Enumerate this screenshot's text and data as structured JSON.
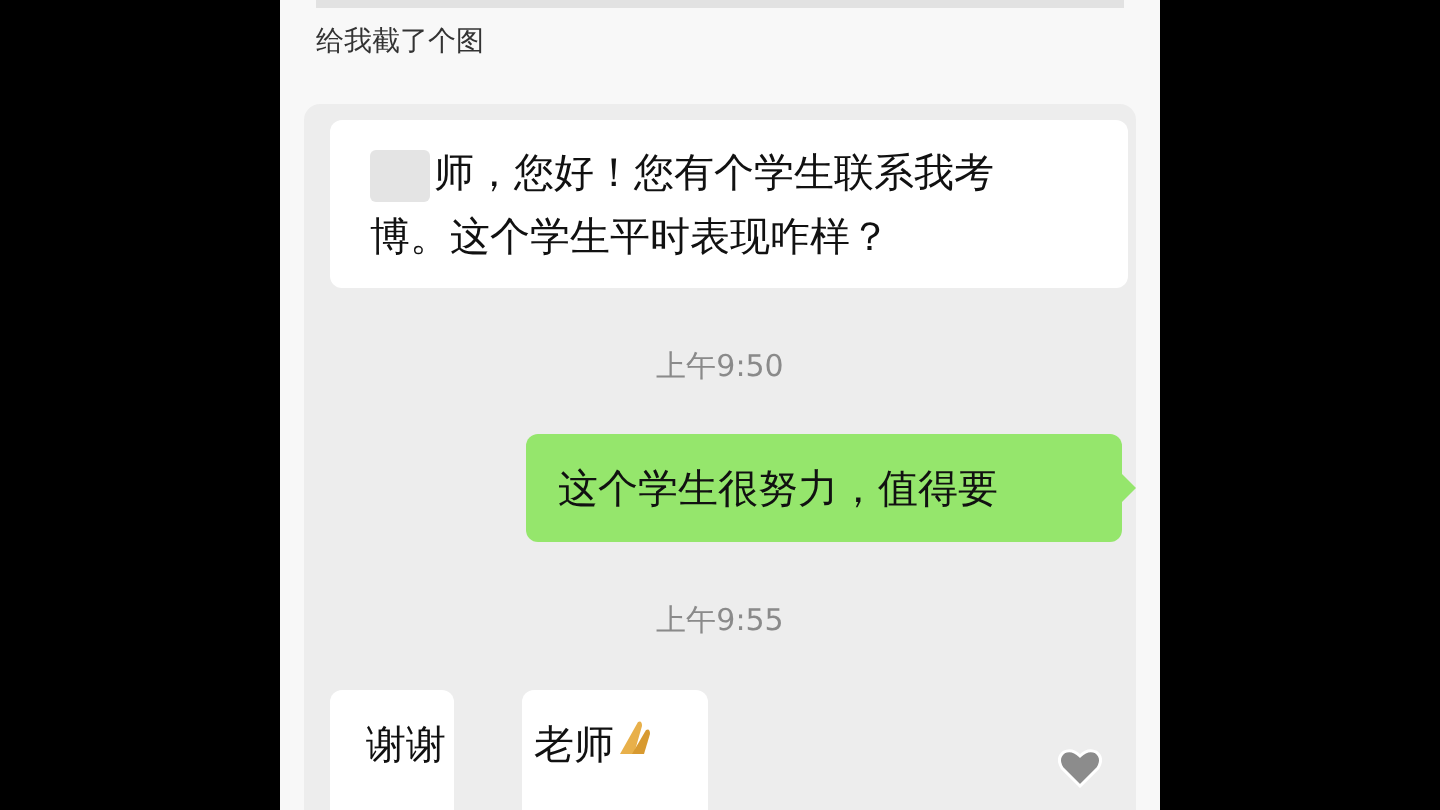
{
  "caption": "给我截了个图",
  "messages": [
    {
      "kind": "received",
      "parts": [
        "师，您好！您有个学生联系我考博。这个学生平时表现咋样？"
      ]
    },
    {
      "kind": "time",
      "text": "上午9:50"
    },
    {
      "kind": "sent",
      "parts": [
        "这个学生很努力，值得要"
      ]
    },
    {
      "kind": "time",
      "text": "上午9:55"
    },
    {
      "kind": "received_split",
      "parts": [
        "谢谢",
        "老师"
      ]
    }
  ]
}
